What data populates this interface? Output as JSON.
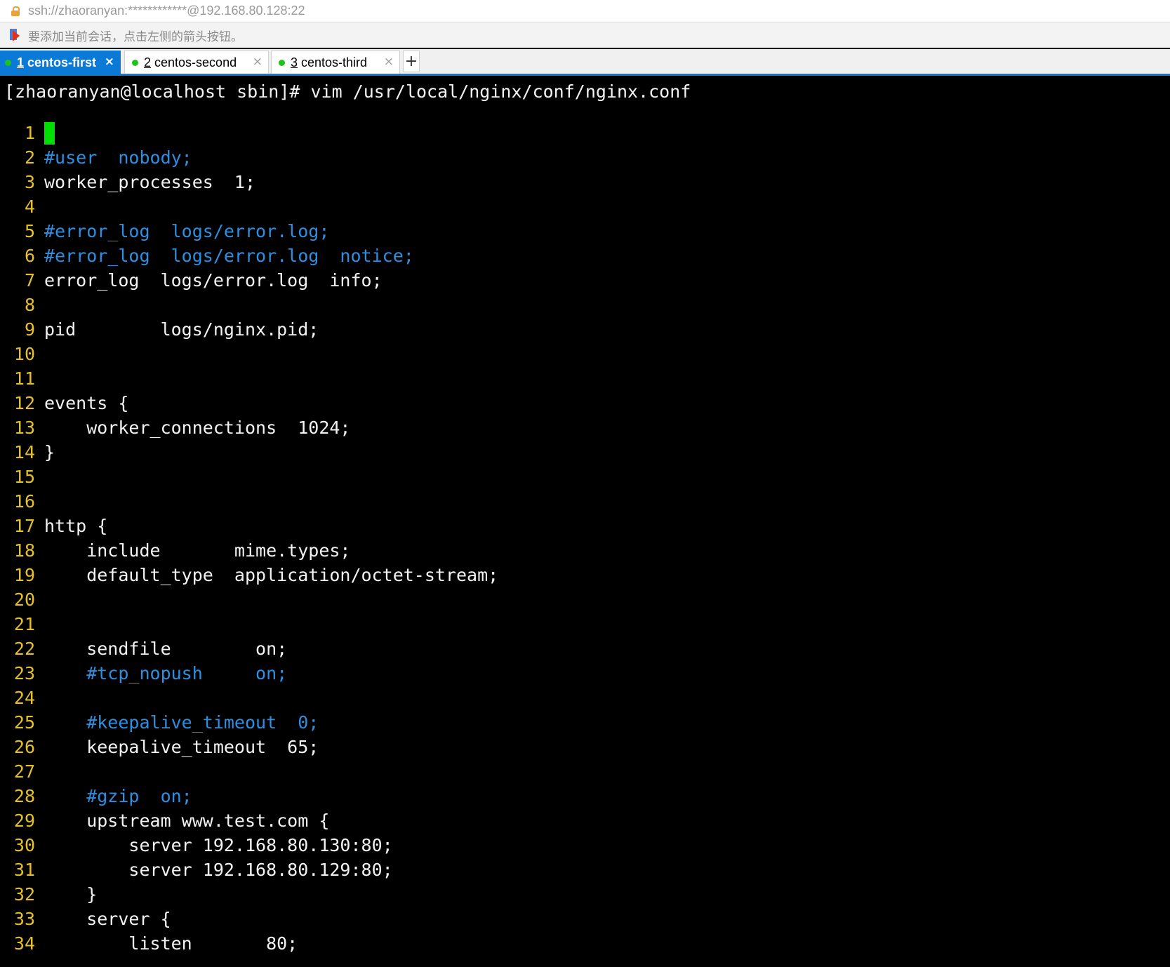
{
  "address_bar": {
    "url": "ssh://zhaoranyan:************@192.168.80.128:22"
  },
  "hint_bar": {
    "text": "要添加当前会话，点击左侧的箭头按钮。"
  },
  "tabs": [
    {
      "num": "1",
      "name": "centos-first",
      "active": true,
      "close": "×"
    },
    {
      "num": "2",
      "name": "centos-second",
      "active": false,
      "close": "×"
    },
    {
      "num": "3",
      "name": "centos-third",
      "active": false,
      "close": "×"
    }
  ],
  "new_tab_label": "+",
  "terminal": {
    "command": "[zhaoranyan@localhost sbin]# vim /usr/local/nginx/conf/nginx.conf",
    "lines": [
      {
        "n": "1",
        "text": "",
        "cursor": true,
        "comment": false
      },
      {
        "n": "2",
        "text": "#user  nobody;",
        "comment": true
      },
      {
        "n": "3",
        "text": "worker_processes  1;",
        "comment": false
      },
      {
        "n": "4",
        "text": "",
        "comment": false
      },
      {
        "n": "5",
        "text": "#error_log  logs/error.log;",
        "comment": true
      },
      {
        "n": "6",
        "text": "#error_log  logs/error.log  notice;",
        "comment": true
      },
      {
        "n": "7",
        "text": "error_log  logs/error.log  info;",
        "comment": false
      },
      {
        "n": "8",
        "text": "",
        "comment": false
      },
      {
        "n": "9",
        "text": "pid        logs/nginx.pid;",
        "comment": false
      },
      {
        "n": "10",
        "text": "",
        "comment": false
      },
      {
        "n": "11",
        "text": "",
        "comment": false
      },
      {
        "n": "12",
        "text": "events {",
        "comment": false
      },
      {
        "n": "13",
        "text": "    worker_connections  1024;",
        "comment": false
      },
      {
        "n": "14",
        "text": "}",
        "comment": false
      },
      {
        "n": "15",
        "text": "",
        "comment": false
      },
      {
        "n": "16",
        "text": "",
        "comment": false
      },
      {
        "n": "17",
        "text": "http {",
        "comment": false
      },
      {
        "n": "18",
        "text": "    include       mime.types;",
        "comment": false
      },
      {
        "n": "19",
        "text": "    default_type  application/octet-stream;",
        "comment": false
      },
      {
        "n": "20",
        "text": "",
        "comment": false
      },
      {
        "n": "21",
        "text": "",
        "comment": false
      },
      {
        "n": "22",
        "text": "    sendfile        on;",
        "comment": false
      },
      {
        "n": "23",
        "text": "    #tcp_nopush     on;",
        "comment": true
      },
      {
        "n": "24",
        "text": "",
        "comment": false
      },
      {
        "n": "25",
        "text": "    #keepalive_timeout  0;",
        "comment": true
      },
      {
        "n": "26",
        "text": "    keepalive_timeout  65;",
        "comment": false
      },
      {
        "n": "27",
        "text": "",
        "comment": false
      },
      {
        "n": "28",
        "text": "    #gzip  on;",
        "comment": true
      },
      {
        "n": "29",
        "text": "    upstream www.test.com {",
        "comment": false
      },
      {
        "n": "30",
        "text": "        server 192.168.80.130:80;",
        "comment": false
      },
      {
        "n": "31",
        "text": "        server 192.168.80.129:80;",
        "comment": false
      },
      {
        "n": "32",
        "text": "    }",
        "comment": false
      },
      {
        "n": "33",
        "text": "    server {",
        "comment": false
      },
      {
        "n": "34",
        "text": "        listen       80;",
        "comment": false
      }
    ]
  },
  "colors": {
    "line_number": "#e5c027",
    "comment": "#2d8fe0",
    "cursor": "#00e000",
    "active_tab": "#0a7ad6",
    "status_dot": "#1bc41b"
  }
}
